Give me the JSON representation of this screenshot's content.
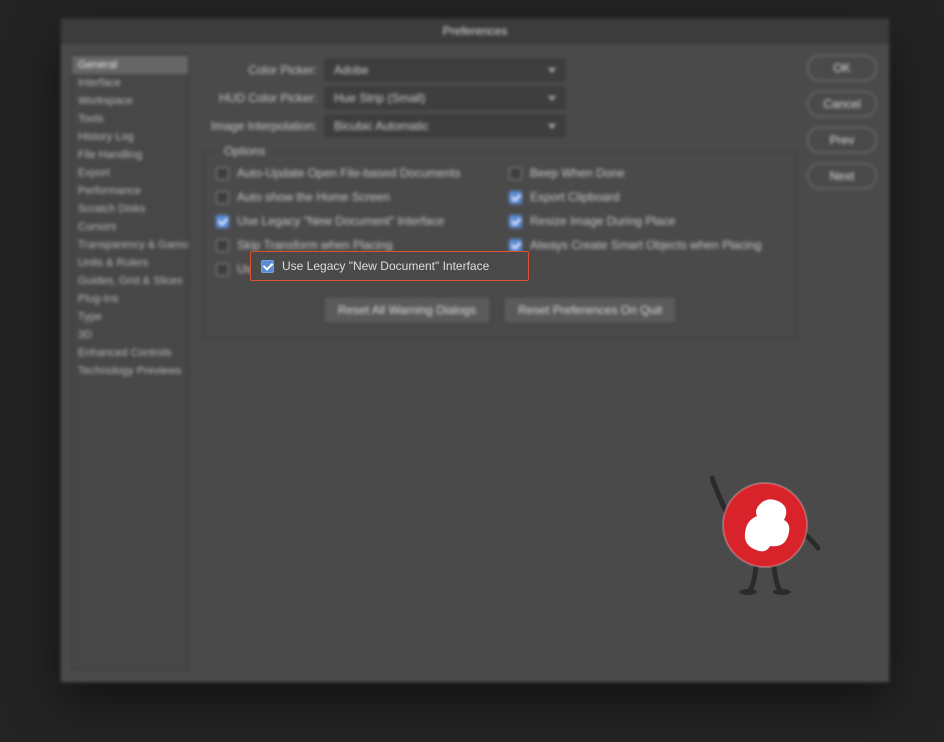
{
  "title": "Preferences",
  "sidebar": {
    "items": [
      {
        "label": "General",
        "selected": true
      },
      {
        "label": "Interface"
      },
      {
        "label": "Workspace"
      },
      {
        "label": "Tools"
      },
      {
        "label": "History Log"
      },
      {
        "label": "File Handling"
      },
      {
        "label": "Export"
      },
      {
        "label": "Performance"
      },
      {
        "label": "Scratch Disks"
      },
      {
        "label": "Cursors"
      },
      {
        "label": "Transparency & Gamut"
      },
      {
        "label": "Units & Rulers"
      },
      {
        "label": "Guides, Grid & Slices"
      },
      {
        "label": "Plug-Ins"
      },
      {
        "label": "Type"
      },
      {
        "label": "3D"
      },
      {
        "label": "Enhanced Controls"
      },
      {
        "label": "Technology Previews"
      }
    ]
  },
  "buttons": {
    "ok": "OK",
    "cancel": "Cancel",
    "prev": "Prev",
    "next": "Next"
  },
  "form": {
    "color_picker": {
      "label": "Color Picker:",
      "value": "Adobe"
    },
    "hud_picker": {
      "label": "HUD Color Picker:",
      "value": "Hue Strip (Small)"
    },
    "interp": {
      "label": "Image Interpolation:",
      "value": "Bicubic Automatic"
    }
  },
  "options": {
    "legend": "Options",
    "items": [
      {
        "label": "Auto-Update Open File-based Documents",
        "checked": false
      },
      {
        "label": "Beep When Done",
        "checked": false
      },
      {
        "label": "Auto show the Home Screen",
        "checked": false
      },
      {
        "label": "Export Clipboard",
        "checked": true
      },
      {
        "label": "Use Legacy \"New Document\" Interface",
        "checked": true,
        "highlighted": true
      },
      {
        "label": "Resize Image During Place",
        "checked": true
      },
      {
        "label": "Skip Transform when Placing",
        "checked": false
      },
      {
        "label": "Always Create Smart Objects when Placing",
        "checked": true
      },
      {
        "label": "Use Legacy Free Transform",
        "checked": false
      }
    ]
  },
  "action_buttons": {
    "reset_warnings": "Reset All Warning Dialogs",
    "reset_on_quit": "Reset Preferences On Quit"
  },
  "highlight": {
    "label": "Use Legacy \"New Document\" Interface"
  }
}
